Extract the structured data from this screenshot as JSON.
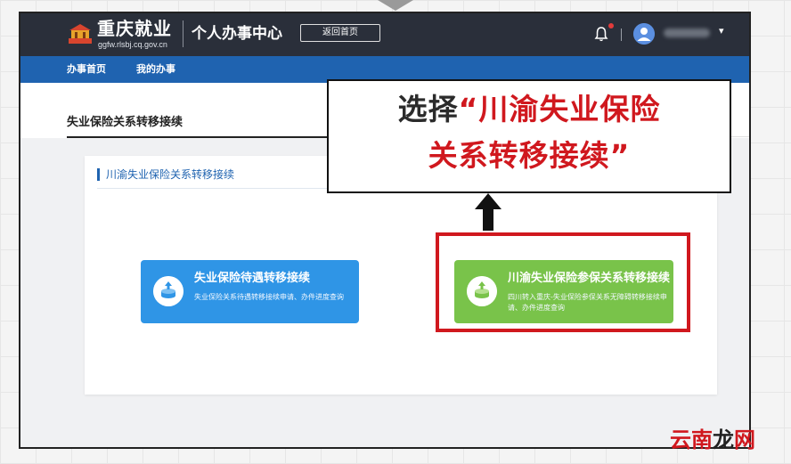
{
  "header": {
    "brand_name": "重庆就业",
    "brand_url": "ggfw.rlsbj.cq.gov.cn",
    "center_title": "个人办事中心",
    "home_button": "返回首页",
    "caret": "▾"
  },
  "nav": {
    "items": [
      "办事首页",
      "我的办事"
    ]
  },
  "page": {
    "title": "失业保险关系转移接续"
  },
  "panel": {
    "title": "川渝失业保险关系转移接续",
    "cards": [
      {
        "title": "失业保险待遇转移接续",
        "desc": "失业保险关系待遇转移接续申请、办件进度查询"
      },
      {
        "title": "川渝失业保险参保关系转移接续",
        "desc": "四川转入重庆-失业保险参保关系无障碍转移接续申请、办件进度查询"
      }
    ]
  },
  "callout": {
    "prefix": "选择",
    "highlight_line1": "“川渝失业保险",
    "highlight_line2": "关系转移接续”"
  },
  "watermark": {
    "part1": "云南",
    "part2": "龙",
    "part3": "网"
  },
  "colors": {
    "topbar": "#2a2f3a",
    "navbar": "#1f63b0",
    "card_blue": "#2f95e6",
    "card_green": "#79c34a",
    "highlight_red": "#d0181e"
  },
  "icons": [
    "bell-icon",
    "avatar-icon",
    "up-arrow-icon",
    "logo-emblem-icon",
    "service-icon"
  ]
}
